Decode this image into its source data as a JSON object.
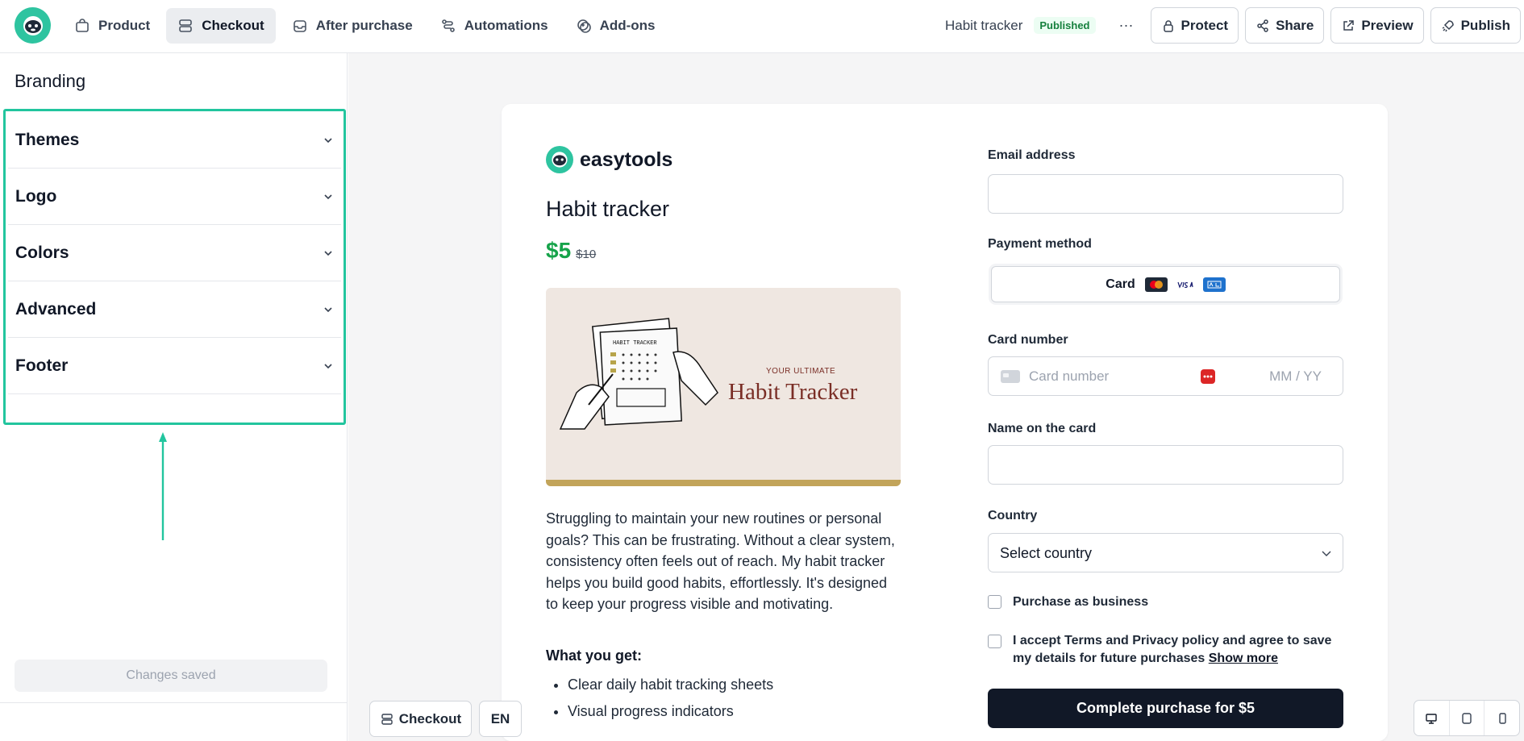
{
  "nav": {
    "items": [
      {
        "label": "Product",
        "icon": "bag-icon",
        "active": false
      },
      {
        "label": "Checkout",
        "icon": "checkout-icon",
        "active": true
      },
      {
        "label": "After purchase",
        "icon": "inbox-icon",
        "active": false
      },
      {
        "label": "Automations",
        "icon": "automation-icon",
        "active": false
      },
      {
        "label": "Add-ons",
        "icon": "addons-icon",
        "active": false
      }
    ]
  },
  "header": {
    "project_title": "Habit tracker",
    "status": "Published",
    "more": "···",
    "protect": "Protect",
    "share": "Share",
    "preview": "Preview",
    "publish": "Publish"
  },
  "sidebar": {
    "title": "Branding",
    "sections": [
      "Themes",
      "Logo",
      "Colors",
      "Advanced",
      "Footer"
    ],
    "saved_label": "Changes saved"
  },
  "checkout": {
    "brand_name": "easytools",
    "product_title": "Habit tracker",
    "price": "$5",
    "old_price": "$10",
    "hero_small": "YOUR ULTIMATE",
    "hero_big": "Habit Tracker",
    "description": "Struggling to maintain your new routines or personal goals? This can be frustrating. Without a clear system, consistency often feels out of reach. My habit tracker helps you build good habits, effortlessly. It's designed to keep your progress visible and motivating.",
    "what_you_get": "What you get:",
    "bullets": [
      "Clear daily habit tracking sheets",
      "Visual progress indicators"
    ]
  },
  "form": {
    "email_label": "Email address",
    "payment_label": "Payment method",
    "payment_option": "Card",
    "card_number_label": "Card number",
    "card_number_placeholder": "Card number",
    "expiry_placeholder": "MM / YY",
    "name_label": "Name on the card",
    "country_label": "Country",
    "country_value": "Select country",
    "business_label": "Purchase as business",
    "terms_text": "I accept Terms and Privacy policy and agree to save my details for future purchases",
    "show_more": "Show more",
    "submit": "Complete purchase for $5"
  },
  "bottom": {
    "checkout_label": "Checkout",
    "language": "EN"
  },
  "colors": {
    "accent": "#22c59e",
    "price_green": "#16a34a",
    "primary_button": "#111827"
  }
}
